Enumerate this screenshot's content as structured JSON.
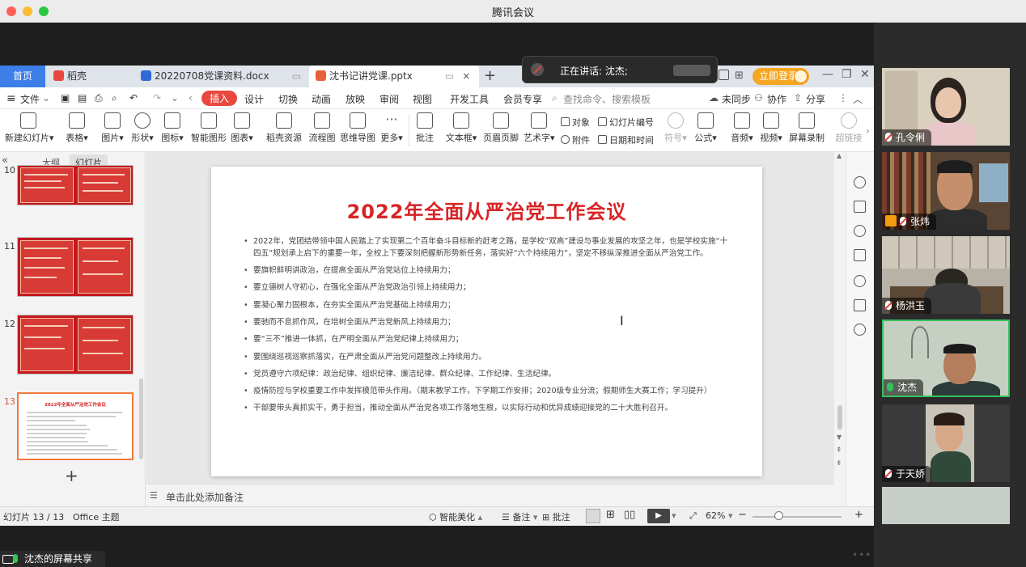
{
  "window": {
    "title": "腾讯会议"
  },
  "wps": {
    "tabs": [
      {
        "label": "首页"
      },
      {
        "label": "稻壳"
      },
      {
        "label": "20220708党课资料.docx"
      },
      {
        "label": "沈书记讲党课.pptx"
      }
    ],
    "login_label": "立即登录",
    "menu": {
      "file": "文件",
      "items": [
        "插入",
        "设计",
        "切换",
        "动画",
        "放映",
        "审阅",
        "视图",
        "开发工具",
        "会员专享"
      ],
      "search_placeholder": "查找命令、搜索模板",
      "unsync": "未同步",
      "collab": "协作",
      "share": "分享"
    },
    "ribbon": {
      "buttons": [
        "新建幻灯片",
        "表格",
        "图片",
        "形状",
        "图标",
        "智能图形",
        "图表",
        "稻壳资源",
        "流程图",
        "思维导图",
        "更多",
        "批注",
        "文本框",
        "页眉页脚",
        "艺术字"
      ],
      "small": [
        "对象",
        "幻灯片编号",
        "附件",
        "日期和时间"
      ],
      "right_buttons": [
        "符号",
        "公式",
        "音频",
        "视频",
        "屏幕录制",
        "超链接"
      ]
    },
    "left_pane": {
      "tabs": [
        "大纲",
        "幻灯片"
      ],
      "slide_numbers": [
        "10",
        "11",
        "12",
        "13"
      ],
      "thumb13_title": "2022年全面从严治党工作会议"
    },
    "slide": {
      "title": "2022年全面从严治党工作会议",
      "bullets": [
        "2022年，党团结带领中国人民踏上了实现第二个百年奋斗目标新的赶考之路，是学校“双高”建设与事业发展的攻坚之年，也是学校实施“十四五”规划承上启下的重要一年，全校上下要深刻把握新形势新任务，落实好“六个持续用力”，坚定不移纵深推进全面从严治党工作。",
        "要旗帜鲜明讲政治，在提高全面从严治党站位上持续用力；",
        "要立德树人守初心，在强化全面从严治党政治引领上持续用力；",
        "要凝心聚力固根本，在夯实全面从严治党基础上持续用力；",
        "要驰而不息抓作风，在培树全面从严治党新风上持续用力；",
        "要“三不”推进一体抓，在严明全面从严治党纪律上持续用力；",
        "要围绕巡视巡察抓落实，在严肃全面从严治党问题整改上持续用力。",
        "党员遵守六项纪律：政治纪律、组织纪律、廉洁纪律、群众纪律、工作纪律、生活纪律。",
        "疫情防控与学校重要工作中发挥模范带头作用。（期末教学工作，下学期工作安排；2020级专业分流；假期师生大赛工作；学习提升）",
        "干部要带头真抓实干，勇于担当，推动全面从严治党各项工作落地生根，以实际行动和优异成绩迎接党的二十大胜利召开。"
      ]
    },
    "notes_placeholder": "单击此处添加备注",
    "status": {
      "slide_counter": "幻灯片 13 / 13",
      "theme": "Office 主题",
      "beautify": "智能美化",
      "notes": "备注",
      "comments": "批注",
      "zoom": "62%"
    }
  },
  "meeting": {
    "speaking": "正在讲话: 沈杰;",
    "participants": [
      {
        "name": "孔令俐",
        "mic": "muted"
      },
      {
        "name": "张炜",
        "mic": "muted"
      },
      {
        "name": "杨洪玉",
        "mic": "muted"
      },
      {
        "name": "沈杰",
        "mic": "active"
      },
      {
        "name": "于天娇",
        "mic": "muted"
      }
    ],
    "screen_share_label": "沈杰的屏幕共享"
  },
  "colors": {
    "accent": "#3d7ee8",
    "insert_tab": "#e8483f",
    "slide_title": "#d82426",
    "speaking_border": "#35c15b"
  }
}
